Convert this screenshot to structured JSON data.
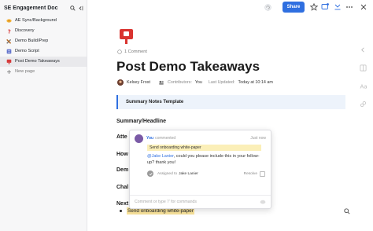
{
  "sidebar": {
    "title": "SE Engagement Doc",
    "items": [
      {
        "label": "AE Sync/Background",
        "icon": "handshake-icon"
      },
      {
        "label": "Discovery",
        "icon": "question-icon"
      },
      {
        "label": "Demo Build/Prep",
        "icon": "tools-icon"
      },
      {
        "label": "Demo Script",
        "icon": "script-icon"
      },
      {
        "label": "Post Demo Takeaways",
        "icon": "takeaway-icon"
      }
    ],
    "new_page_label": "New page"
  },
  "topbar": {
    "share_label": "Share"
  },
  "doc": {
    "comment_count": "1 Comment",
    "title": "Post Demo Takeaways",
    "author": "Kelsey Frost",
    "contributors_label": "Contributors:",
    "contributors_value": "You",
    "last_updated_label": "Last Updated:",
    "last_updated_value": "Today at 10:14 am",
    "callout": "Summary Notes Template",
    "headings": {
      "summary": "Summary/Headline",
      "attendees": "Atte",
      "how": "How",
      "demo": "Dem",
      "challenges": "Chal",
      "next": "Next"
    },
    "bullet_text": "Send onboarding white-paper"
  },
  "comment": {
    "author": "You",
    "verb": "commented",
    "time": "Just now",
    "quote": "Send onboarding white-paper",
    "mention": "@Jake Lanier",
    "body": ", could you please include this in your follow-up? thank you!",
    "assigned_label": "Assigned to",
    "assignee": "Jake Lanier",
    "resolve_label": "Resolve",
    "input_placeholder": "Comment or type '/' for commands"
  },
  "colors": {
    "accent": "#2f6fe0",
    "highlight": "#f9e29a",
    "callout_bg": "#edf3fb"
  }
}
